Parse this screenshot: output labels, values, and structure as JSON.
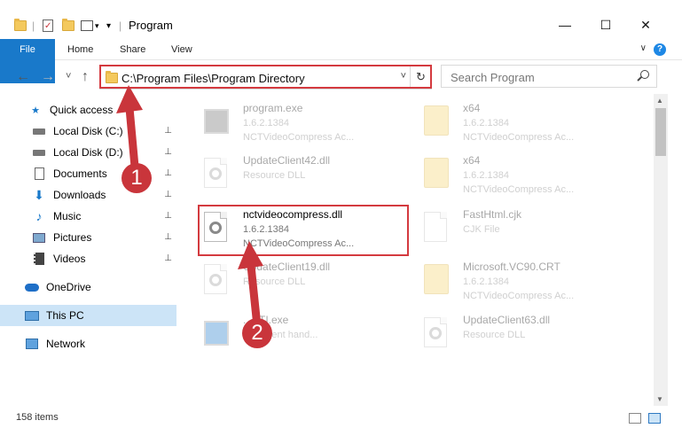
{
  "window": {
    "title": "Program",
    "minimize": "—",
    "maximize": "☐",
    "close": "✕"
  },
  "ribbon": {
    "tabs": [
      "File",
      "Home",
      "Share",
      "View"
    ],
    "expand": "∨",
    "help": "?"
  },
  "nav": {
    "back": "←",
    "forward": "→",
    "recent": "˅",
    "up": "↑",
    "address": "C:\\Program Files\\Program Directory",
    "refresh": "↻",
    "dropdown": "˅",
    "search_placeholder": "Search Program"
  },
  "sidebar": {
    "items": [
      {
        "label": "Quick access",
        "icon": "star-icon"
      },
      {
        "label": "Local Disk (C:)",
        "icon": "drive-icon",
        "pinned": true
      },
      {
        "label": "Local Disk (D:)",
        "icon": "drive-icon",
        "pinned": true
      },
      {
        "label": "Documents",
        "icon": "documents-icon",
        "pinned": true
      },
      {
        "label": "Downloads",
        "icon": "downloads-icon",
        "pinned": true
      },
      {
        "label": "Music",
        "icon": "music-icon",
        "pinned": true
      },
      {
        "label": "Pictures",
        "icon": "pictures-icon",
        "pinned": true
      },
      {
        "label": "Videos",
        "icon": "videos-icon",
        "pinned": true
      },
      {
        "label": "OneDrive",
        "icon": "cloud-icon"
      },
      {
        "label": "This PC",
        "icon": "pc-icon",
        "selected": true
      },
      {
        "label": "Network",
        "icon": "network-icon"
      }
    ],
    "pin_glyph": "📌"
  },
  "files": {
    "program_exe": {
      "name": "program.exe",
      "line2": "1.6.2.1384",
      "line3": "NCTVideoCompress Ac..."
    },
    "updateclient42": {
      "name": "UpdateClient42.dll",
      "line2": "Resource DLL"
    },
    "nctvideocompress": {
      "name": "nctvideocompress.dll",
      "line2": "1.6.2.1384",
      "line3": "NCTVideoCompress Ac..."
    },
    "updateclient19": {
      "name": "UpdateClient19.dll",
      "line2": "Resource DLL"
    },
    "sti_exe": {
      "name": "...STI.exe",
      "line2": "...dl event hand..."
    },
    "x64_1": {
      "name": "x64",
      "line2": "1.6.2.1384",
      "line3": "NCTVideoCompress Ac..."
    },
    "x64_2": {
      "name": "x64",
      "line2": "1.6.2.1384",
      "line3": "NCTVideoCompress Ac..."
    },
    "fasthtml": {
      "name": "FastHtml.cjk",
      "line2": "CJK File"
    },
    "msvc90": {
      "name": "Microsoft.VC90.CRT",
      "line2": "1.6.2.1384",
      "line3": "NCTVideoCompress Ac..."
    },
    "updateclient63": {
      "name": "UpdateClient63.dll",
      "line2": "Resource DLL"
    }
  },
  "annotations": {
    "badge1": "1",
    "badge2": "2"
  },
  "status": {
    "count": "158 items"
  },
  "colors": {
    "accent": "#1979ca",
    "highlight": "#d43a3f",
    "selection": "#cce4f7"
  }
}
